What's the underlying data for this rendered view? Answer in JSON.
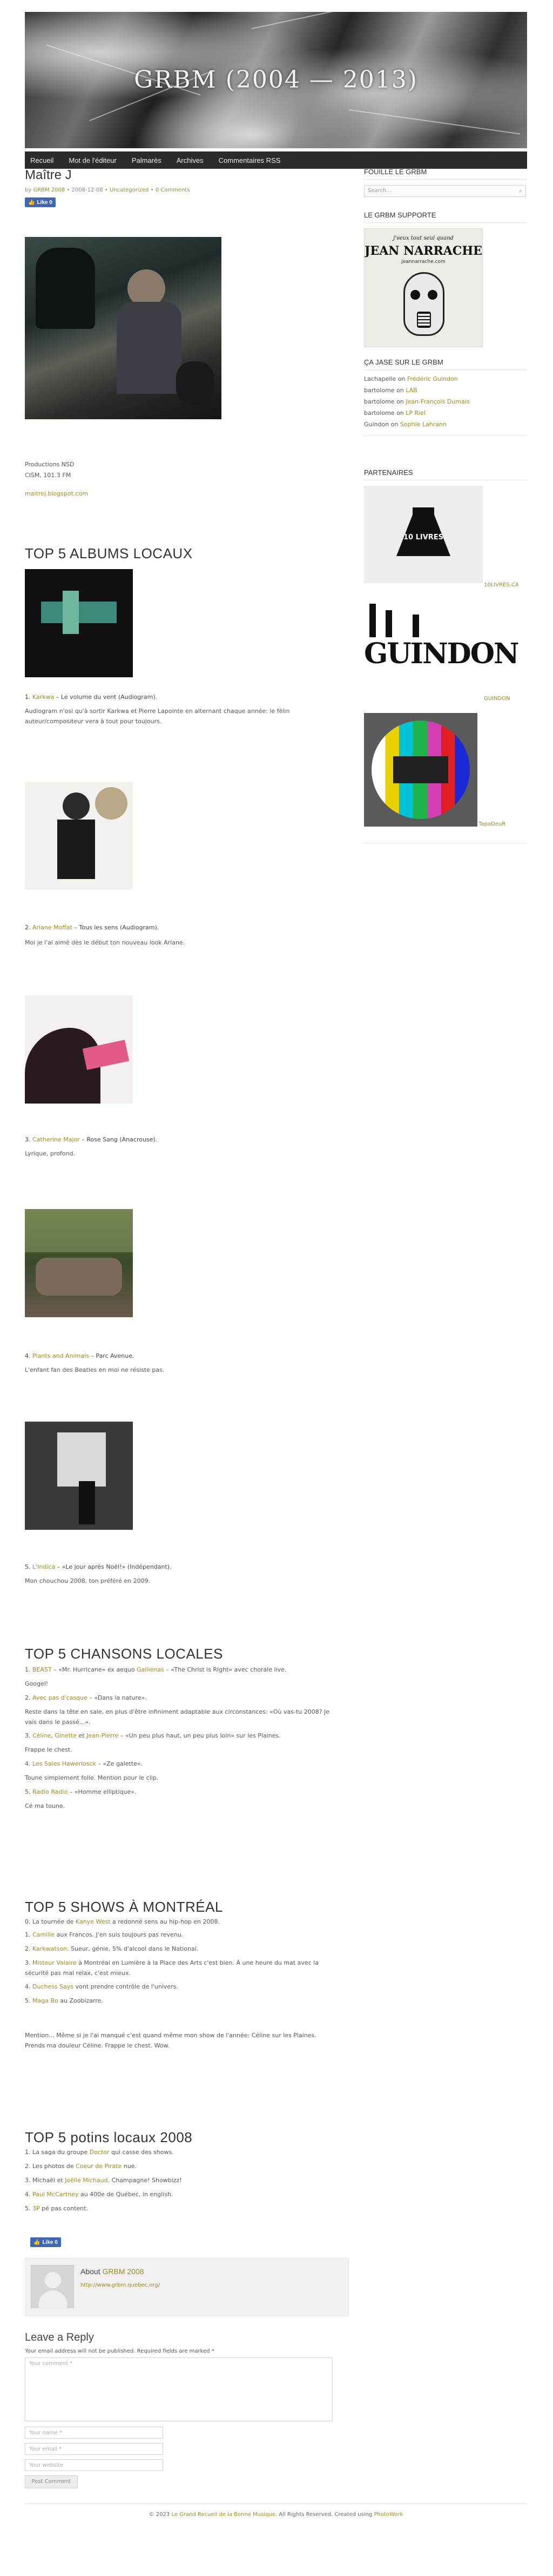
{
  "site": {
    "title": "GRBM (2004 — 2013)"
  },
  "nav": [
    "Recueil",
    "Mot de l'éditeur",
    "Palmarès",
    "Archives",
    "Commentaires RSS"
  ],
  "post": {
    "title": "Maître J",
    "meta_by": "by",
    "meta_author": "GRBM 2008",
    "meta_date": "• 2008-12-08 •",
    "meta_cats": "Uncategorized",
    "meta_sep": "•",
    "meta_comments": "0 Comments",
    "fb_like": "Like 0",
    "credits": [
      "Productions NSD",
      "CISM, 101.3 FM"
    ],
    "blog_link": "maitrej.blogspot.com"
  },
  "albums": {
    "heading": "TOP 5 ALBUMS LOCAUX",
    "items": [
      {
        "num": "1.",
        "artist": "Karkwa",
        "title": " – Le volume du vent (Audiogram).",
        "text": "Audiogram n'osi qu'à sortir Karkwa et Pierre Lapointe en alternant chaque année: le fèlin auteur/compositeur vera à tout pour toujours."
      },
      {
        "num": "2.",
        "artist": "Ariane Moffat",
        "title": " – Tous les sens (Audiogram).",
        "text": "Moi je l'ai aimé dès le début ton nouveau look Ariane."
      },
      {
        "num": "3.",
        "artist": "Catherine Major",
        "title": " – Rose Sang (Anacrouse).",
        "text": "Lyrique, profond."
      },
      {
        "num": "4.",
        "artist": "Plants and Animals",
        "title": " – Parc Avenue.",
        "text": "L'enfant fan des Beatles en moi ne résiste pas."
      },
      {
        "num": "5.",
        "artist": "L'Indica",
        "title": " – «Le jour après Noël!» (Indépendant).",
        "text": "Mon chouchou 2008, ton préféré en 2009."
      }
    ]
  },
  "songs": {
    "heading": "TOP 5 CHANSONS LOCALES",
    "lines": [
      {
        "num": "1.",
        "parts": [
          {
            "t": "BEAST",
            "link": true
          },
          {
            "t": " – «Mr. Hurricane» ex aequo ",
            "link": false
          },
          {
            "t": "Gallienas",
            "link": true
          },
          {
            "t": " – «The Christ is Right» avec chorale live.",
            "link": false
          }
        ]
      },
      {
        "num": "",
        "parts": [
          {
            "t": "Googel!",
            "link": false
          }
        ]
      },
      {
        "num": "2.",
        "parts": [
          {
            "t": "Avec pas d'casque",
            "link": true
          },
          {
            "t": " – «Dans la nature».",
            "link": false
          }
        ]
      },
      {
        "num": "",
        "parts": [
          {
            "t": "Reste dans la tête en sale, en plus d'être infiniment adaptable aux circonstances: «Où vas-tu 2008? Je vais dans le passé...».",
            "link": false
          }
        ]
      },
      {
        "num": "3.",
        "parts": [
          {
            "t": "Céline",
            "link": true
          },
          {
            "t": ", ",
            "link": false
          },
          {
            "t": "Ginette",
            "link": true
          },
          {
            "t": " et ",
            "link": false
          },
          {
            "t": "Jean-Pierre",
            "link": true
          },
          {
            "t": " – «Un peu plus haut, un peu plus loin» sur les Plaines.",
            "link": false
          }
        ]
      },
      {
        "num": "",
        "parts": [
          {
            "t": "Frappe le chest.",
            "link": false
          }
        ]
      },
      {
        "num": "4.",
        "parts": [
          {
            "t": "Les Sales Hawerlosck",
            "link": true
          },
          {
            "t": " – «Ze galette».",
            "link": false
          }
        ]
      },
      {
        "num": "",
        "parts": [
          {
            "t": "Toune simplement folle. Mention pour le clip.",
            "link": false
          }
        ]
      },
      {
        "num": "5.",
        "parts": [
          {
            "t": "Radio Radio",
            "link": true
          },
          {
            "t": " – «Homme elliptique».",
            "link": false
          }
        ]
      },
      {
        "num": "",
        "parts": [
          {
            "t": "Cé ma toune.",
            "link": false
          }
        ]
      }
    ]
  },
  "shows": {
    "heading": "TOP 5 SHOWS À MONTRÉAL",
    "intro_pre": "0. La tournée de ",
    "intro_link": "Kanye West",
    "intro_post": " a redonné sens au hip-hop en 2008.",
    "items": [
      {
        "num": "1.",
        "artist": "Camille",
        "text": " aux Francos. J'en suis toujours pas revenu."
      },
      {
        "num": "2.",
        "artist": "Karkwatson",
        "text": ". Sueur, génie, 5% d'alcool dans le National."
      },
      {
        "num": "3.",
        "artist": "Misteur Valaire",
        "text": " à Montréal en Lumière à la Place des Arts c'est bien. À une heure du mat avec la sécurité pas mal relax, c'est mieux."
      },
      {
        "num": "4.",
        "artist": "Duchess Says",
        "text": " vont prendre contrôle de l'univers."
      },
      {
        "num": "5.",
        "artist": "Maga Bo",
        "text": " au Zoobizarre."
      }
    ],
    "outro": "Mention... Même si je l'ai manqué c'est quand même mon show de l'année: Céline sur les Plaines. Prends ma douleur Céline. Frappe le chest. Wow."
  },
  "gossip": {
    "heading": "TOP 5 potins locaux 2008",
    "items": [
      {
        "num": "1.",
        "parts": [
          {
            "t": "La saga du groupe ",
            "link": false
          },
          {
            "t": "Doctor",
            "link": true
          },
          {
            "t": " qui casse des shows.",
            "link": false
          }
        ]
      },
      {
        "num": "2.",
        "parts": [
          {
            "t": "Les photos de ",
            "link": false
          },
          {
            "t": "Coeur de Pirate",
            "link": true
          },
          {
            "t": " nue.",
            "link": false
          }
        ]
      },
      {
        "num": "3.",
        "parts": [
          {
            "t": "Michaël",
            "link": false
          },
          {
            "t": " et ",
            "link": false
          },
          {
            "t": "Joëlle Michaud",
            "link": true
          },
          {
            "t": ". Champagne! Showbizz!",
            "link": false
          }
        ]
      },
      {
        "num": "4.",
        "parts": [
          {
            "t": "Paul McCartney",
            "link": true
          },
          {
            "t": " au 400e de Québec, in english.",
            "link": false
          }
        ]
      },
      {
        "num": "5.",
        "parts": [
          {
            "t": "3P",
            "link": true
          },
          {
            "t": " pé pas content.",
            "link": false
          }
        ]
      }
    ]
  },
  "author": {
    "about": "About",
    "name": "GRBM 2008",
    "url": "http://www.grbm.quebec.org/"
  },
  "reply": {
    "heading": "Leave a Reply",
    "note": "Your email address will not be published. Required fields are marked *",
    "comment_placeholder": "Your comment *",
    "name_placeholder": "Your name *",
    "email_placeholder": "Your email *",
    "website_placeholder": "Your website",
    "submit": "Post Comment"
  },
  "sidebar": {
    "follow_title": "FOUILLE LE GRBM",
    "search_placeholder": "Search...",
    "supports_title": "LE GRBM SUPPORTE",
    "poster_line1": "j'veux tout seul quand",
    "poster_line2": "JEAN NARRACHE",
    "poster_line3": "jeannarrache.com",
    "comments_title": "ÇA JASE SUR LE GRBM",
    "comments": [
      {
        "who": "Lachapelle",
        "on": "on",
        "where": "Frédéric Guindon"
      },
      {
        "who": "bartolome",
        "on": "on",
        "where": "LAB"
      },
      {
        "who": "bartolome",
        "on": "on",
        "where": "Jean-François Dumais"
      },
      {
        "who": "bartolome",
        "on": "on",
        "where": "LP Riel"
      },
      {
        "who": "Guindon",
        "on": "on",
        "where": "Sophie Lahrann"
      }
    ],
    "partners_title": "PARTENAIRES",
    "partners": [
      {
        "logo": "10 LIVRES",
        "label": "10LIVRES.CA"
      },
      {
        "logo": "GUINDON",
        "label": "GUINDON"
      },
      {
        "logo": "",
        "label": "TapaDeuR"
      }
    ]
  },
  "footer": {
    "pre": "© 2023 ",
    "site": "Le Grand Recueil de la Bonne Musique",
    "mid": ". All Rights Reserved. Created using ",
    "theme": "PhotoWork"
  }
}
